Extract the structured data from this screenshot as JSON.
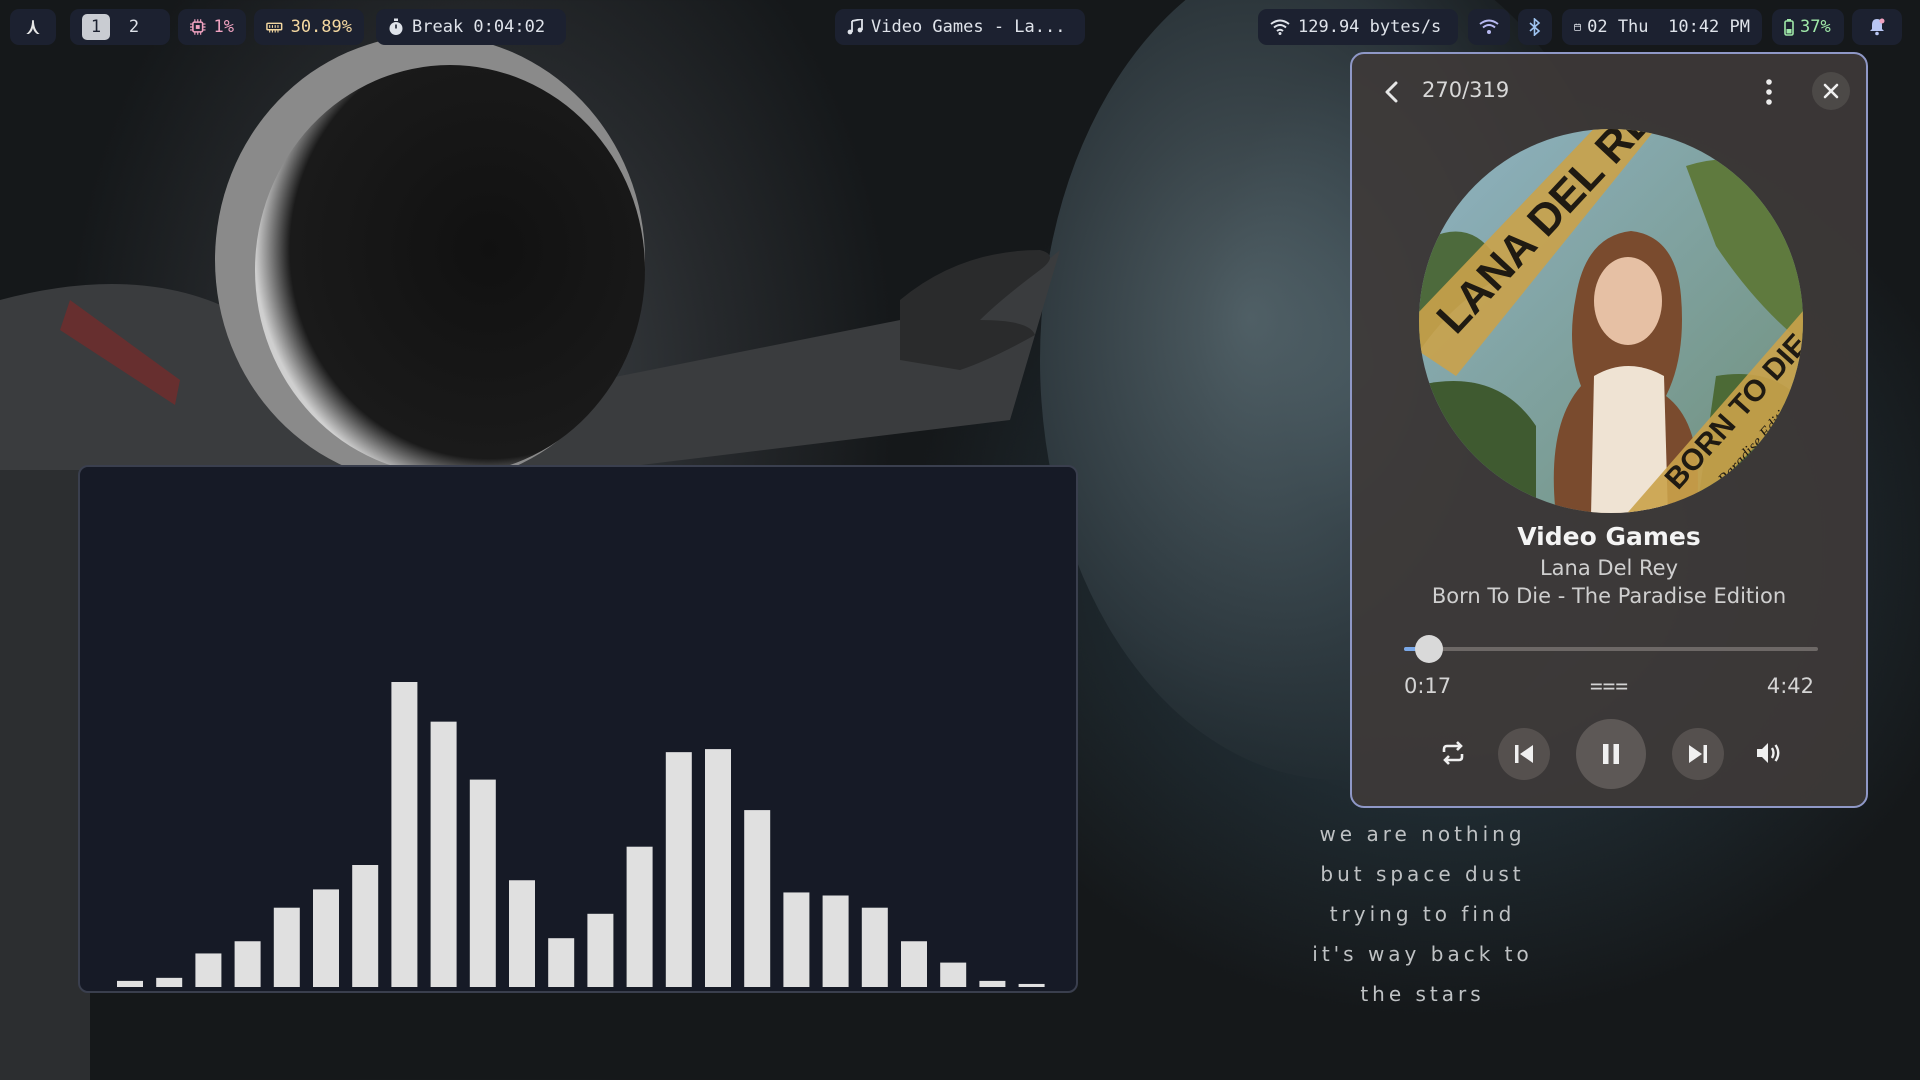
{
  "topbar": {
    "logo_glyph": "⋏",
    "workspaces": [
      {
        "label": "1",
        "active": true
      },
      {
        "label": "2",
        "active": false
      }
    ],
    "cpu": {
      "icon": "cpu-icon",
      "value": "1%"
    },
    "memory": {
      "icon": "memory-icon",
      "value": "30.89%"
    },
    "timer": {
      "icon": "stopwatch-icon",
      "label": "Break 0:04:02"
    },
    "media": {
      "icon": "music-note-icon",
      "label": "Video Games - La..."
    },
    "network": {
      "icon": "wifi-icon",
      "speed": "129.94 bytes/s"
    },
    "wifi_status_icon": "wifi-signal-icon",
    "bluetooth_icon": "bluetooth-icon",
    "clock": {
      "icon": "calendar-icon",
      "date": "02 Thu",
      "time": "10:42 PM"
    },
    "battery": {
      "icon": "battery-icon",
      "value": "37%"
    },
    "notifications_icon": "bell-icon"
  },
  "player": {
    "track_position": "270/319",
    "title": "Video Games",
    "artist": "Lana Del Rey",
    "album": "Born To Die - The Paradise Edition",
    "elapsed": "0:17",
    "duration": "4:42",
    "progress_fraction": 0.06,
    "mode_indicator": "===",
    "cover_text": {
      "band": "LANA DEL REY",
      "title": "BORN TO DIE",
      "subtitle": "The Paradise Edition"
    },
    "colors": {
      "accent": "#7aa8e8",
      "border": "#8f98c7"
    }
  },
  "visualizer": {
    "bar_levels": [
      0.02,
      0.03,
      0.11,
      0.15,
      0.26,
      0.32,
      0.4,
      1.0,
      0.87,
      0.68,
      0.35,
      0.16,
      0.24,
      0.46,
      0.77,
      0.78,
      0.58,
      0.31,
      0.3,
      0.26,
      0.15,
      0.08,
      0.02,
      0.01
    ],
    "bar_color": "#e0e0e0"
  },
  "lyrics": {
    "lines": [
      "we are nothing",
      "but space dust",
      "trying to find",
      "it's way back to",
      "the stars"
    ]
  }
}
